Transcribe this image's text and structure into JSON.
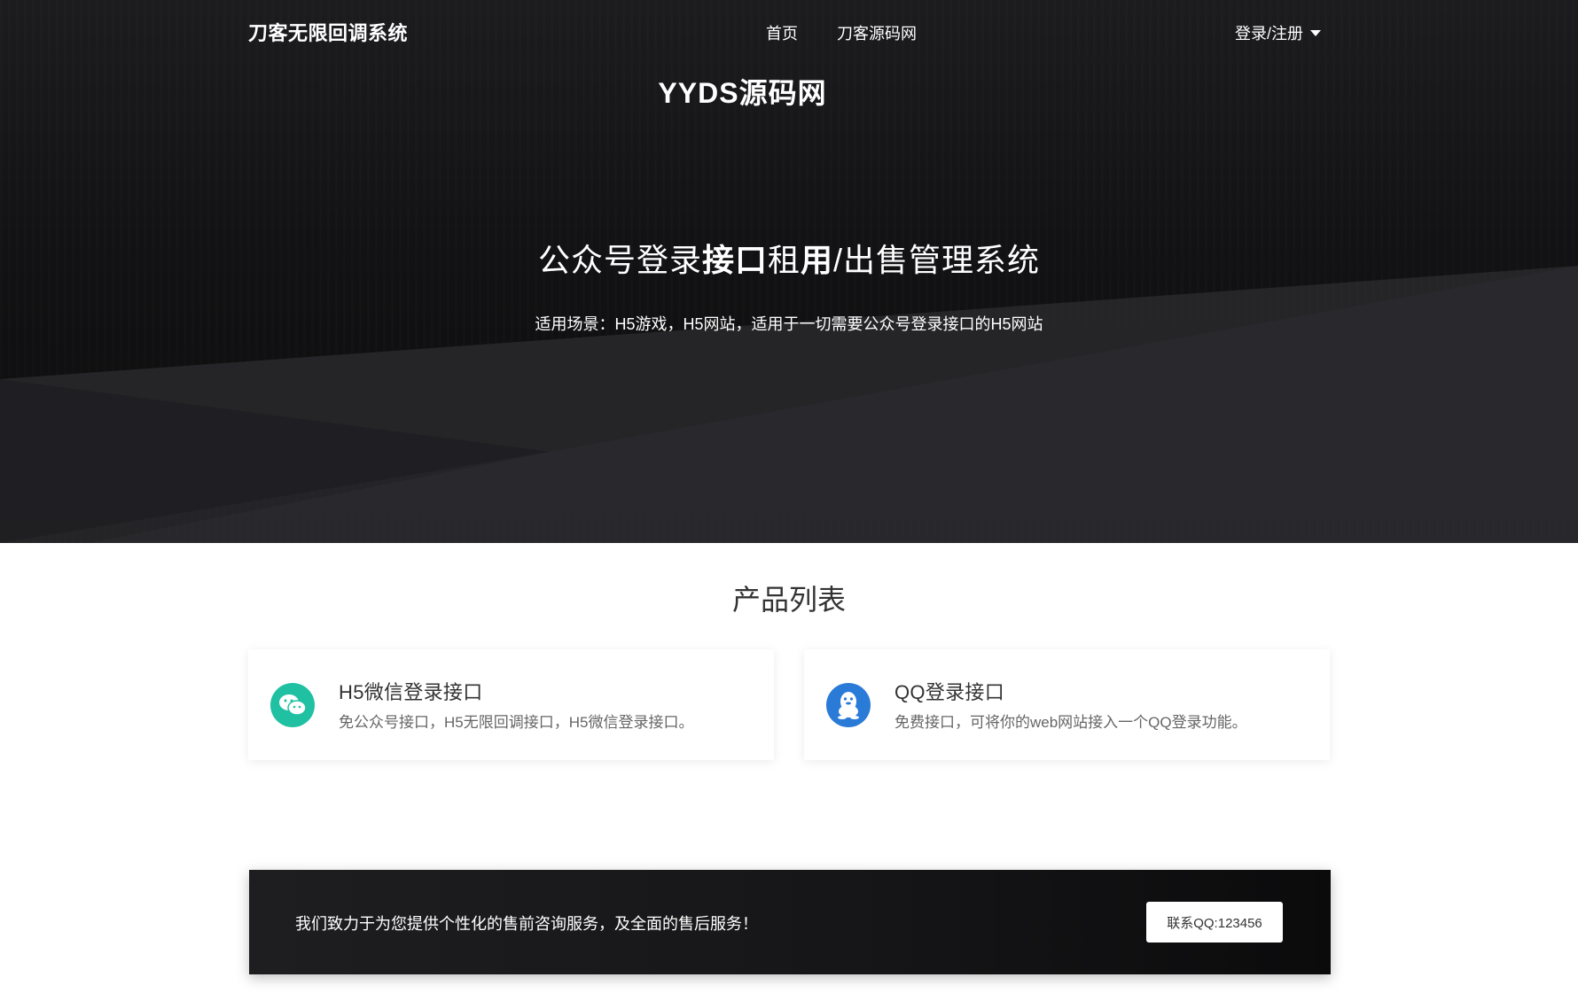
{
  "nav": {
    "brand": "刀客无限回调系统",
    "links": [
      {
        "label": "首页"
      },
      {
        "label": "刀客源码网"
      }
    ],
    "login_label": "登录/注册"
  },
  "hero": {
    "logo_text": "YYDS源码网",
    "title_part1": "公众号登录",
    "title_bold1": "接口",
    "title_part2": "租",
    "title_bold2": "用",
    "title_part3": "/出售管理系统",
    "subtitle": "适用场景：H5游戏，H5网站，适用于一切需要公众号登录接口的H5网站"
  },
  "products": {
    "section_title": "产品列表",
    "items": [
      {
        "title": "H5微信登录接口",
        "desc": "免公众号接口，H5无限回调接口，H5微信登录接口。",
        "icon": "wechat-icon",
        "color": "#1fc1a2"
      },
      {
        "title": "QQ登录接口",
        "desc": "免费接口，可将你的web网站接入一个QQ登录功能。",
        "icon": "qq-penguin-icon",
        "color": "#2a7ad8"
      }
    ]
  },
  "banner": {
    "text": "我们致力于为您提供个性化的售前咨询服务，及全面的售后服务！",
    "button_label": "联系QQ:123456"
  }
}
